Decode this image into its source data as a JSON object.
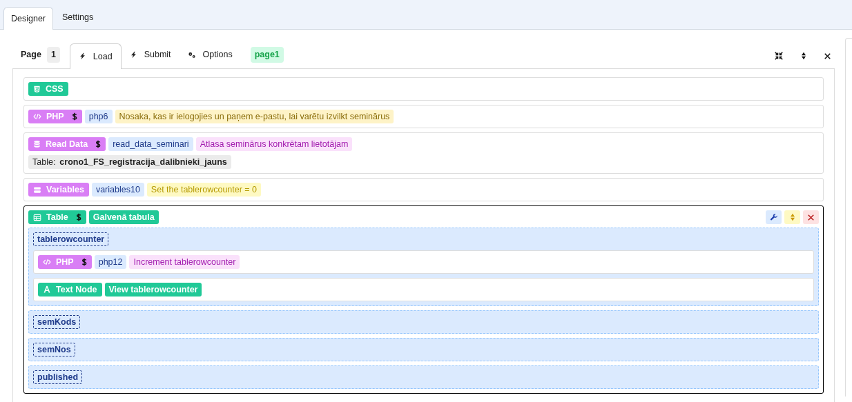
{
  "tabs": [
    {
      "label": "Designer",
      "selected": true
    },
    {
      "label": "Settings",
      "selected": false
    }
  ],
  "page_bar": {
    "label": "Page",
    "number": "1",
    "page_name": "page1",
    "tabs": [
      {
        "label": "Load",
        "kind": "event",
        "selected": true
      },
      {
        "label": "Submit",
        "kind": "event",
        "selected": false
      },
      {
        "label": "Options",
        "kind": "options",
        "selected": false
      }
    ]
  },
  "blocks": [
    {
      "selected": false,
      "badge": {
        "label": "CSS",
        "kind": "css"
      }
    },
    {
      "selected": false,
      "badge": {
        "label": "PHP",
        "kind": "php",
        "dollar": true
      },
      "tags": [
        {
          "kind": "id",
          "text": "php6"
        },
        {
          "kind": "amber",
          "text": "Nosaka, kas ir ielogojies un paņem e-pastu, lai varētu izvilkt seminārus"
        }
      ]
    },
    {
      "selected": false,
      "badge": {
        "label": "Read Data",
        "kind": "read_data",
        "dollar": true
      },
      "tags": [
        {
          "kind": "id",
          "text": "read_data_seminari"
        },
        {
          "kind": "pink",
          "text": "Atlasa seminārus konkrētam lietotājam"
        }
      ],
      "table_ref": {
        "label": "Table:",
        "value": "crono1_FS_registracija_dalibnieki_jauns"
      }
    },
    {
      "selected": false,
      "badge": {
        "label": "Variables",
        "kind": "variables"
      },
      "tags": [
        {
          "kind": "id",
          "text": "variables10"
        },
        {
          "kind": "yellow",
          "text": "Set the tablerowcounter = 0"
        }
      ]
    },
    {
      "selected": true,
      "badge": {
        "label": "Table",
        "kind": "table",
        "dollar": true
      },
      "tags": [
        {
          "kind": "teal",
          "text": "Galvenā tabula"
        }
      ],
      "columns": [
        {
          "name": "tablerowcounter",
          "children": [
            {
              "selected": false,
              "badge": {
                "label": "PHP",
                "kind": "php",
                "dollar": true
              },
              "tags": [
                {
                  "kind": "id",
                  "text": "php12"
                },
                {
                  "kind": "pink",
                  "text": "Increment tablerowcounter"
                }
              ]
            },
            {
              "selected": false,
              "badge": {
                "label": "Text Node",
                "kind": "text_node"
              },
              "tags": [
                {
                  "kind": "teal",
                  "text": "View tablerowcounter"
                }
              ]
            }
          ]
        },
        {
          "name": "semKods"
        },
        {
          "name": "semNos"
        },
        {
          "name": "published"
        }
      ]
    }
  ]
}
